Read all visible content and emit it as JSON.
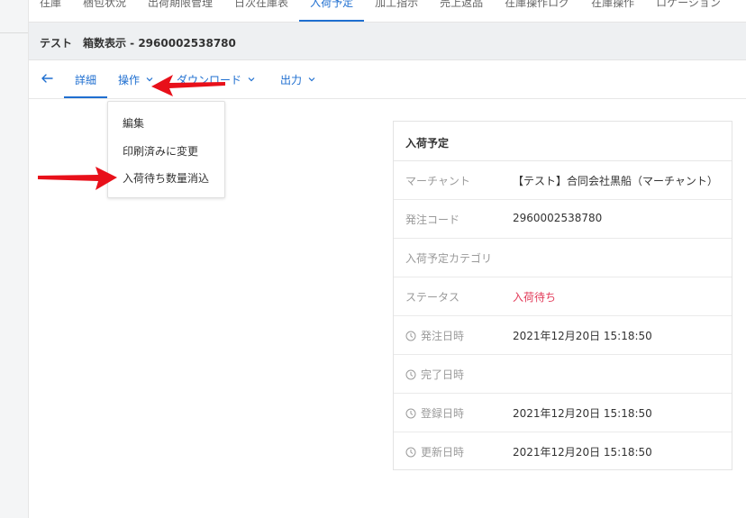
{
  "topnav": {
    "items": [
      "往庫",
      "梱包状況",
      "出荷期限管理",
      "日次在庫表",
      "入荷予定",
      "加工指示",
      "売上返品",
      "在庫操作ログ",
      "在庫操作",
      "ロケーション"
    ],
    "active_index": 4
  },
  "page": {
    "title": "テスト　箱数表示 - 2960002538780"
  },
  "subnav": {
    "detail": "詳細",
    "operation": "操作",
    "download": "ダウンロード",
    "output": "出力"
  },
  "dropdown": {
    "items": [
      "編集",
      "印刷済みに変更",
      "入荷待ち数量消込"
    ]
  },
  "card": {
    "title": "入荷予定",
    "rows": [
      {
        "label": "マーチャント",
        "value": "【テスト】合同会社黒船（マーチャント）"
      },
      {
        "label": "発注コード",
        "value": "2960002538780"
      },
      {
        "label": "入荷予定カテゴリ",
        "value": ""
      },
      {
        "label": "ステータス",
        "value": "入荷待ち"
      },
      {
        "label": "発注日時",
        "value": "2021年12月20日 15:18:50"
      },
      {
        "label": "完了日時",
        "value": ""
      },
      {
        "label": "登録日時",
        "value": "2021年12月20日 15:18:50"
      },
      {
        "label": "更新日時",
        "value": "2021年12月20日 15:18:50"
      }
    ]
  },
  "colors": {
    "accent": "#1f6fd0",
    "status": "#e23c5a",
    "annotation_arrow": "#e8101a"
  }
}
